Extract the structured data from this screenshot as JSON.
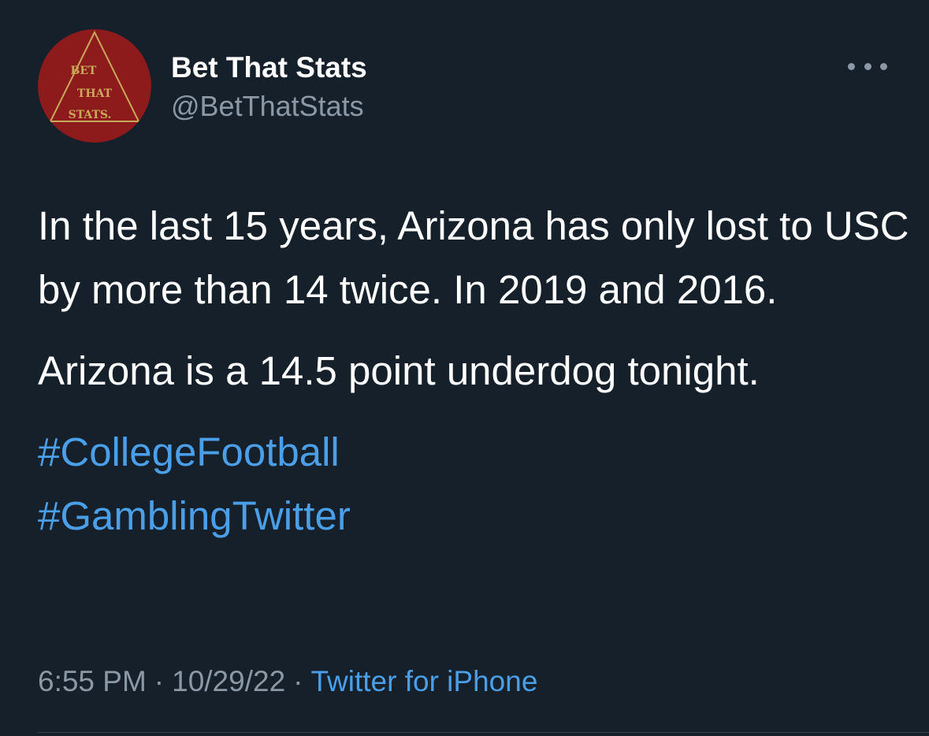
{
  "author": {
    "display_name": "Bet That Stats",
    "handle": "@BetThatStats",
    "avatar_text": [
      "BET",
      "THAT",
      "STATS."
    ]
  },
  "menu": {
    "icon": "more-horizontal-icon"
  },
  "tweet": {
    "paragraph_1": "In the last 15 years, Arizona has only lost to USC by more than 14 twice. In 2019 and 2016.",
    "paragraph_2": "Arizona is a 14.5 point underdog tonight.",
    "hashtags": [
      "#CollegeFootball",
      "#GamblingTwitter"
    ]
  },
  "meta": {
    "time": "6:55 PM",
    "date": "10/29/22",
    "separator": "·",
    "source": "Twitter for iPhone"
  },
  "colors": {
    "background": "#15202b",
    "text_primary": "#ffffff",
    "text_secondary": "#8b98a5",
    "link": "#4a9fe8",
    "avatar_red": "#8e1b1c",
    "avatar_gold": "#c9a85a"
  }
}
